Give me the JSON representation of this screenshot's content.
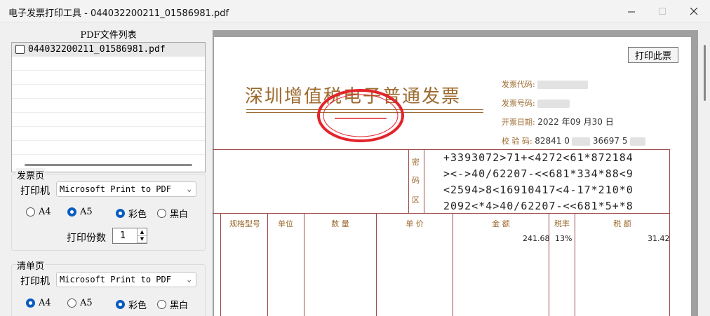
{
  "window": {
    "title": "电子发票打印工具 - 044032200211_01586981.pdf",
    "minimize_icon": "minimize-icon",
    "maximize_icon": "maximize-icon",
    "close_icon": "close-icon"
  },
  "file_list": {
    "title": "PDF文件列表",
    "items": [
      {
        "name": "044032200211_01586981.pdf",
        "checked": false
      }
    ]
  },
  "invoice_page_group": {
    "label": "发票页",
    "printer_label": "打印机",
    "printer_value": "Microsoft Print to PDF",
    "paper_options": [
      "A4",
      "A5"
    ],
    "paper_selected": "A5",
    "color_options": [
      "彩色",
      "黑白"
    ],
    "color_selected": "彩色",
    "copies_label": "打印份数",
    "copies_value": "1"
  },
  "list_page_group": {
    "label": "清单页",
    "printer_label": "打印机",
    "printer_value": "Microsoft Print to PDF",
    "paper_options": [
      "A4",
      "A5"
    ],
    "paper_selected": "A4",
    "color_options": [
      "彩色",
      "黑白"
    ],
    "color_selected": "彩色"
  },
  "preview": {
    "print_button": "打印此票",
    "invoice_title": "深圳增值税电子普通发票",
    "fields": {
      "code_label": "发票代码:",
      "number_label": "发票号码:",
      "date_label": "开票日期:",
      "date_value": "2022 年09 月30 日",
      "check_label": "校 验 码:",
      "check_value": "82841 0",
      "check_value_2": "36697 5"
    },
    "cipher_label": [
      "密",
      "码",
      "区"
    ],
    "cipher_lines": [
      "+3393072>71+<4272<61*872184",
      "><->40/62207-<<681*334*88<9",
      "<2594>8<16910417<4-17*210*0",
      "2092<*4>40/62207-<<681*5+*8"
    ],
    "columns": [
      "规格型号",
      "单位",
      "数 量",
      "单 价",
      "金 额",
      "税率",
      "税 额"
    ],
    "amount": "241.68",
    "tax_rate": "13%",
    "tax_amount": "31.42",
    "colors": {
      "title": "#9c6a2f",
      "frame": "#9d4a4a",
      "stamp": "#e3242b"
    }
  }
}
